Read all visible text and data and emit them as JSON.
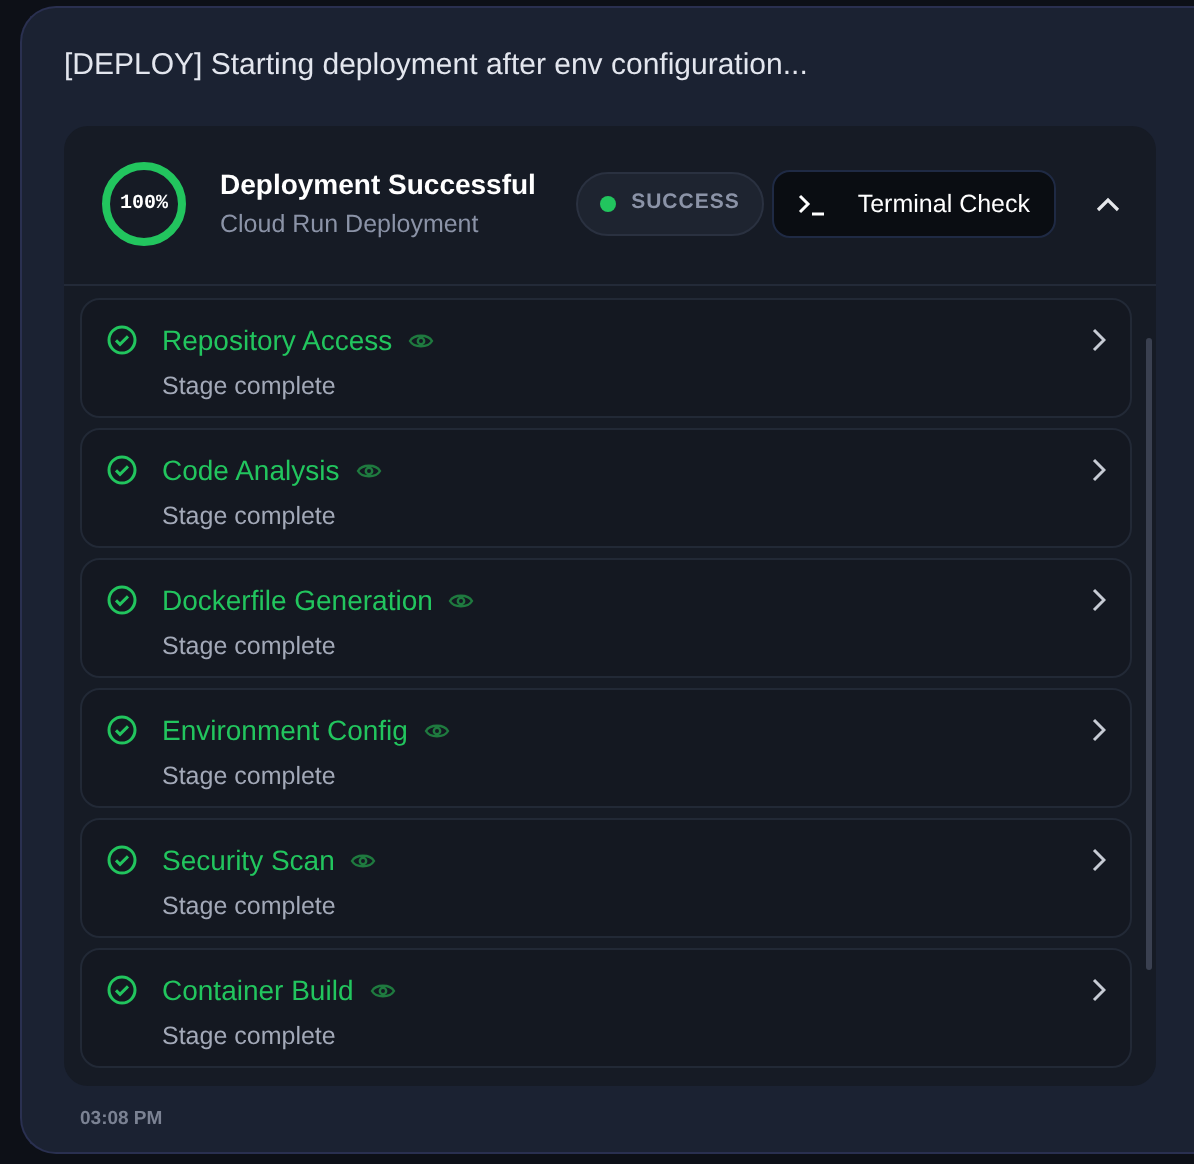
{
  "message": "[DEPLOY] Starting deployment after env configuration...",
  "deployment": {
    "progress_label": "100%",
    "level": 1,
    "title": "Deployment Successful",
    "subtitle": "Cloud Run Deployment",
    "status": "SUCCESS",
    "terminal_button": "Terminal Check",
    "expanded": true
  },
  "stages": [
    {
      "name": "Repository Access",
      "detail": "Stage complete",
      "done": true
    },
    {
      "name": "Code Analysis",
      "detail": "Stage complete",
      "done": true
    },
    {
      "name": "Dockerfile Generation",
      "detail": "Stage complete",
      "done": true
    },
    {
      "name": "Environment Config",
      "detail": "Stage complete",
      "done": true
    },
    {
      "name": "Security Scan",
      "detail": "Stage complete",
      "done": true
    },
    {
      "name": "Container Build",
      "detail": "Stage complete",
      "done": true
    }
  ],
  "time": "03:08 PM"
}
